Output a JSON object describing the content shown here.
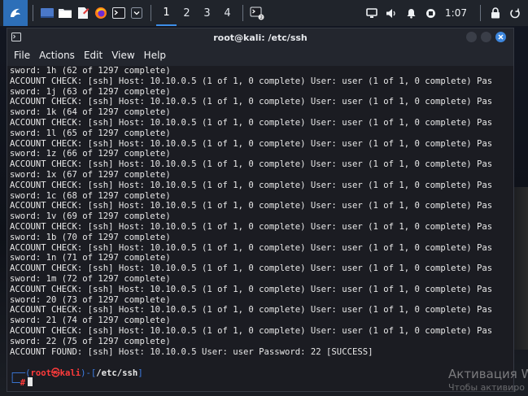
{
  "panel": {
    "workspaces": [
      "1",
      "2",
      "3",
      "4"
    ],
    "active_workspace": "1",
    "clock": "1:07",
    "accent": "#3d8ee8"
  },
  "window": {
    "title": "root@kali: /etc/ssh",
    "menu": [
      "File",
      "Actions",
      "Edit",
      "View",
      "Help"
    ]
  },
  "terminal": {
    "lines": [
      "sword: 1h (62 of 1297 complete)",
      "ACCOUNT CHECK: [ssh] Host: 10.10.0.5 (1 of 1, 0 complete) User: user (1 of 1, 0 complete) Pas",
      "sword: 1j (63 of 1297 complete)",
      "ACCOUNT CHECK: [ssh] Host: 10.10.0.5 (1 of 1, 0 complete) User: user (1 of 1, 0 complete) Pas",
      "sword: 1k (64 of 1297 complete)",
      "ACCOUNT CHECK: [ssh] Host: 10.10.0.5 (1 of 1, 0 complete) User: user (1 of 1, 0 complete) Pas",
      "sword: 1l (65 of 1297 complete)",
      "ACCOUNT CHECK: [ssh] Host: 10.10.0.5 (1 of 1, 0 complete) User: user (1 of 1, 0 complete) Pas",
      "sword: 1z (66 of 1297 complete)",
      "ACCOUNT CHECK: [ssh] Host: 10.10.0.5 (1 of 1, 0 complete) User: user (1 of 1, 0 complete) Pas",
      "sword: 1x (67 of 1297 complete)",
      "ACCOUNT CHECK: [ssh] Host: 10.10.0.5 (1 of 1, 0 complete) User: user (1 of 1, 0 complete) Pas",
      "sword: 1c (68 of 1297 complete)",
      "ACCOUNT CHECK: [ssh] Host: 10.10.0.5 (1 of 1, 0 complete) User: user (1 of 1, 0 complete) Pas",
      "sword: 1v (69 of 1297 complete)",
      "ACCOUNT CHECK: [ssh] Host: 10.10.0.5 (1 of 1, 0 complete) User: user (1 of 1, 0 complete) Pas",
      "sword: 1b (70 of 1297 complete)",
      "ACCOUNT CHECK: [ssh] Host: 10.10.0.5 (1 of 1, 0 complete) User: user (1 of 1, 0 complete) Pas",
      "sword: 1n (71 of 1297 complete)",
      "ACCOUNT CHECK: [ssh] Host: 10.10.0.5 (1 of 1, 0 complete) User: user (1 of 1, 0 complete) Pas",
      "sword: 1m (72 of 1297 complete)",
      "ACCOUNT CHECK: [ssh] Host: 10.10.0.5 (1 of 1, 0 complete) User: user (1 of 1, 0 complete) Pas",
      "sword: 20 (73 of 1297 complete)",
      "ACCOUNT CHECK: [ssh] Host: 10.10.0.5 (1 of 1, 0 complete) User: user (1 of 1, 0 complete) Pas",
      "sword: 21 (74 of 1297 complete)",
      "ACCOUNT CHECK: [ssh] Host: 10.10.0.5 (1 of 1, 0 complete) User: user (1 of 1, 0 complete) Pas",
      "sword: 22 (75 of 1297 complete)",
      "ACCOUNT FOUND: [ssh] Host: 10.10.0.5 User: user Password: 22 [SUCCESS]"
    ],
    "prompt": {
      "open": "┌──(",
      "user": "root",
      "at": "㉿",
      "host": "kali",
      "close": ")-[",
      "path": "/etc/ssh",
      "end": "]",
      "line2": "└─",
      "symbol": "#"
    }
  },
  "watermark": {
    "title": "Активация W",
    "subtitle": "Чтобы активиро"
  }
}
